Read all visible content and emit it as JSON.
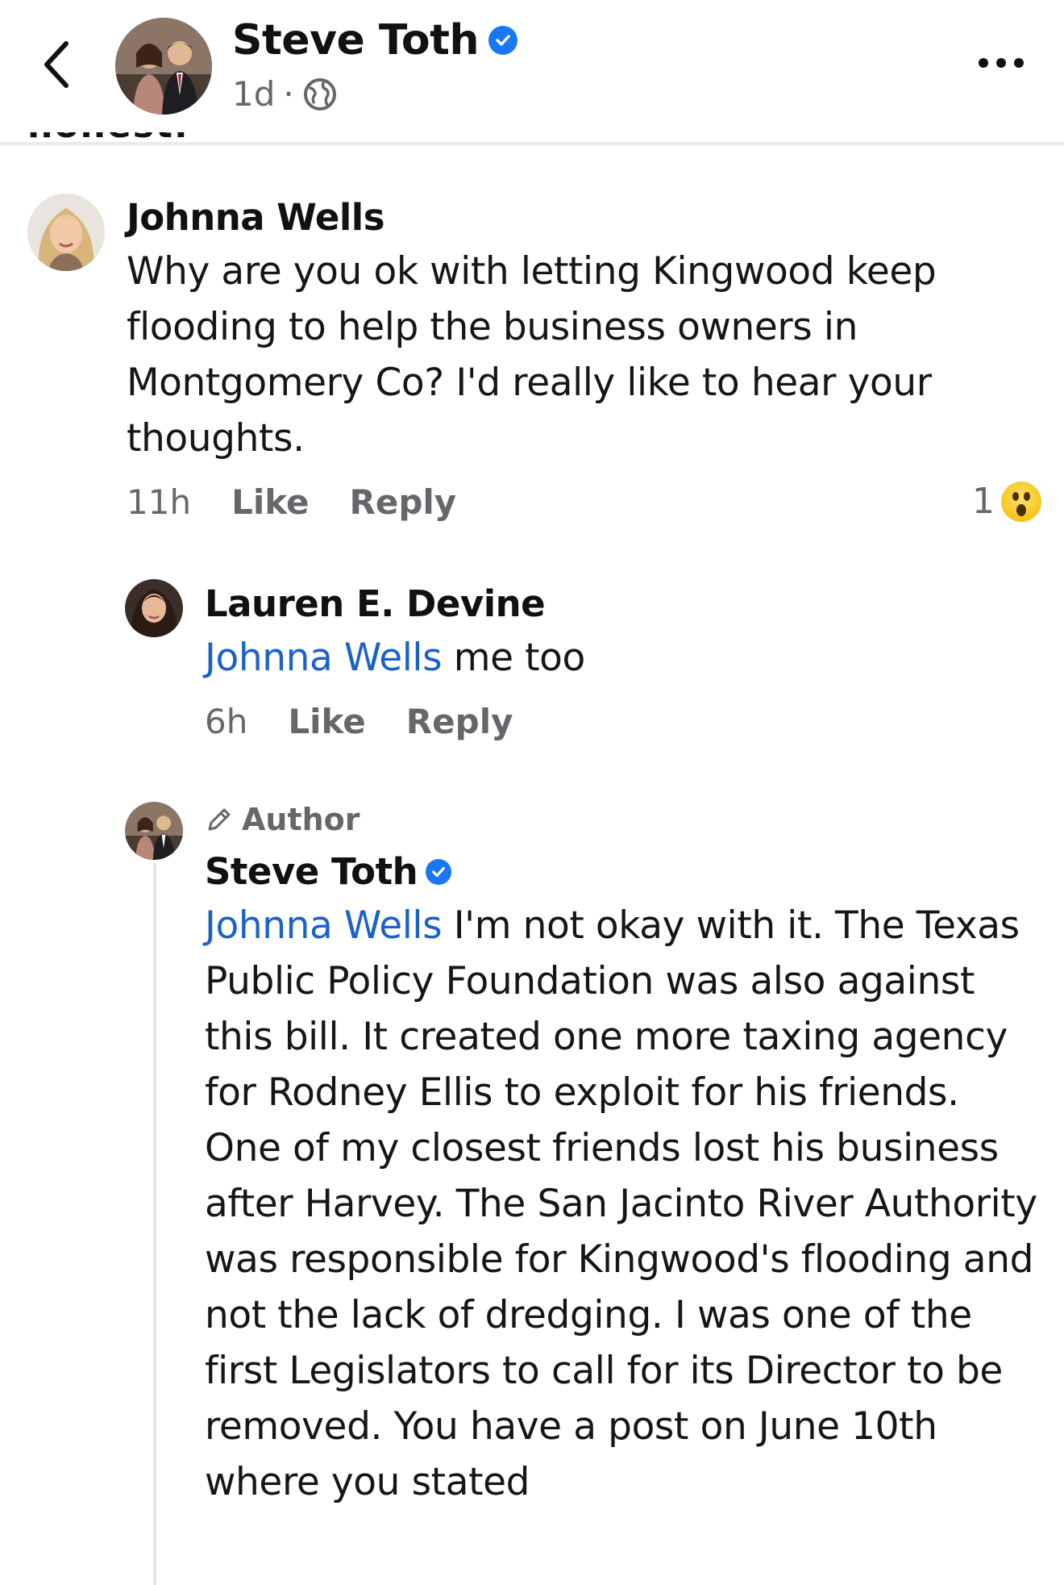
{
  "header": {
    "name": "Steve Toth",
    "verified": true,
    "time": "1d",
    "separator": "·",
    "audience_icon": "globe-icon",
    "back_icon": "chevron-left-icon",
    "more_icon": "more-horizontal-icon"
  },
  "cut_off_text": "honest.",
  "comments": [
    {
      "name": "Johnna Wells",
      "text": "Why are you ok with letting Kingwood keep flooding to help the business owners in Montgomery Co? I'd really like to hear your thoughts.",
      "time": "11h",
      "like": "Like",
      "reply": "Reply",
      "reaction_count": "1",
      "reaction_icon": "wow-reaction-icon"
    },
    {
      "name": "Lauren E. Devine",
      "mention": "Johnna Wells",
      "text": " me too",
      "time": "6h",
      "like": "Like",
      "reply": "Reply"
    },
    {
      "badge": "Author",
      "badge_icon": "pencil-icon",
      "name": "Steve Toth",
      "verified": true,
      "mention": "Johnna Wells",
      "text": " I'm not okay with it. The Texas Public Policy Foundation was also against this bill. It created one more taxing agency for Rodney Ellis to exploit for his friends. One of my closest friends lost his business after Harvey. The San Jacinto River Authority was responsible for Kingwood's flooding and not the lack of dredging. I was one of the first Legislators to call for its Director to be removed. You have a post on June 10th where you stated"
    }
  ],
  "colors": {
    "link": "#1a62c9",
    "verified": "#1877f2",
    "meta_gray": "#65676b"
  }
}
